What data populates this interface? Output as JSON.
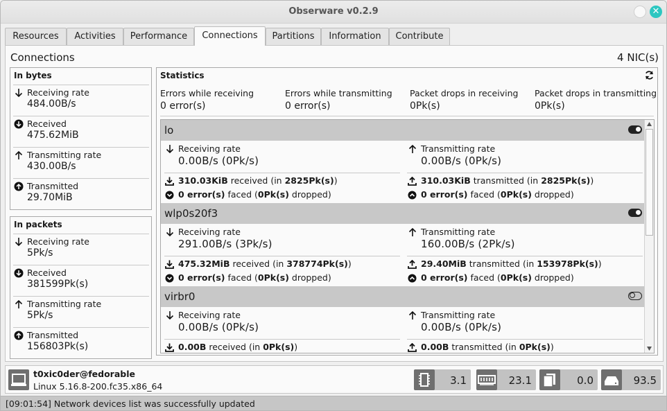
{
  "window": {
    "title": "Obserware v0.2.9"
  },
  "tabs": [
    "Resources",
    "Activities",
    "Performance",
    "Connections",
    "Partitions",
    "Information",
    "Contribute"
  ],
  "active_tab": "Connections",
  "page": {
    "title": "Connections",
    "nic_count": "4 NIC(s)"
  },
  "in_bytes": {
    "title": "In bytes",
    "rows": [
      {
        "label": "Receiving rate",
        "value": "484.00B/s",
        "icon": "arrow-down-icon"
      },
      {
        "label": "Received",
        "value": "475.62MiB",
        "icon": "circle-arrow-down-icon"
      },
      {
        "label": "Transmitting rate",
        "value": "430.00B/s",
        "icon": "arrow-up-icon"
      },
      {
        "label": "Transmitted",
        "value": "29.70MiB",
        "icon": "circle-arrow-up-icon"
      }
    ]
  },
  "in_packets": {
    "title": "In packets",
    "rows": [
      {
        "label": "Receiving rate",
        "value": "5Pk/s",
        "icon": "arrow-down-icon"
      },
      {
        "label": "Received",
        "value": "381599Pk(s)",
        "icon": "circle-arrow-down-icon"
      },
      {
        "label": "Transmitting rate",
        "value": "5Pk/s",
        "icon": "arrow-up-icon"
      },
      {
        "label": "Transmitted",
        "value": "156803Pk(s)",
        "icon": "circle-arrow-up-icon"
      }
    ]
  },
  "statistics": {
    "title": "Statistics",
    "columns": [
      {
        "label": "Errors while receiving",
        "value": "0 error(s)"
      },
      {
        "label": "Errors while transmitting",
        "value": "0 error(s)"
      },
      {
        "label": "Packet drops in receiving",
        "value": "0Pk(s)"
      },
      {
        "label": "Packet drops in transmitting",
        "value": "0Pk(s)"
      }
    ]
  },
  "nics": [
    {
      "name": "lo",
      "enabled": true,
      "rx_label": "Receiving rate",
      "rx_rate": "0.00B/s (0Pk/s)",
      "rx_total": "310.03KiB",
      "rx_word": "received (in",
      "rx_pk": "2825Pk(s)",
      "rx_close": ")",
      "rx_err": "0 error(s)",
      "rx_err_word": "faced (",
      "rx_drop": "0Pk(s)",
      "rx_drop_word": "dropped)",
      "tx_label": "Transmitting rate",
      "tx_rate": "0.00B/s (0Pk/s)",
      "tx_total": "310.03KiB",
      "tx_word": "transmitted (in",
      "tx_pk": "2825Pk(s)",
      "tx_close": ")",
      "tx_err": "0 error(s)",
      "tx_err_word": "faced (",
      "tx_drop": "0Pk(s)",
      "tx_drop_word": "dropped)"
    },
    {
      "name": "wlp0s20f3",
      "enabled": true,
      "rx_label": "Receiving rate",
      "rx_rate": "291.00B/s (3Pk/s)",
      "rx_total": "475.32MiB",
      "rx_word": "received (in",
      "rx_pk": "378774Pk(s)",
      "rx_close": ")",
      "rx_err": "0 error(s)",
      "rx_err_word": "faced (",
      "rx_drop": "0Pk(s)",
      "rx_drop_word": "dropped)",
      "tx_label": "Transmitting rate",
      "tx_rate": "160.00B/s (2Pk/s)",
      "tx_total": "29.40MiB",
      "tx_word": "transmitted (in",
      "tx_pk": "153978Pk(s)",
      "tx_close": ")",
      "tx_err": "0 error(s)",
      "tx_err_word": "faced (",
      "tx_drop": "0Pk(s)",
      "tx_drop_word": "dropped)"
    },
    {
      "name": "virbr0",
      "enabled": false,
      "rx_label": "Receiving rate",
      "rx_rate": "0.00B/s (0Pk/s)",
      "rx_total": "0.00B",
      "rx_word": "received (in",
      "rx_pk": "0Pk(s)",
      "rx_close": ")",
      "tx_label": "Transmitting rate",
      "tx_rate": "0.00B/s (0Pk/s)",
      "tx_total": "0.00B",
      "tx_word": "transmitted (in",
      "tx_pk": "0Pk(s)",
      "tx_close": ")"
    }
  ],
  "footer": {
    "user_host": "t0xic0der@fedorable",
    "kernel": "Linux 5.16.8-200.fc35.x86_64",
    "usage": [
      {
        "icon": "cpu-icon",
        "value": "3.1"
      },
      {
        "icon": "memory-icon",
        "value": "23.1"
      },
      {
        "icon": "swap-icon",
        "value": "0.0"
      },
      {
        "icon": "disk-icon",
        "value": "93.5"
      }
    ]
  },
  "status": {
    "message": "[09:01:54] Network devices list was successfully updated"
  }
}
